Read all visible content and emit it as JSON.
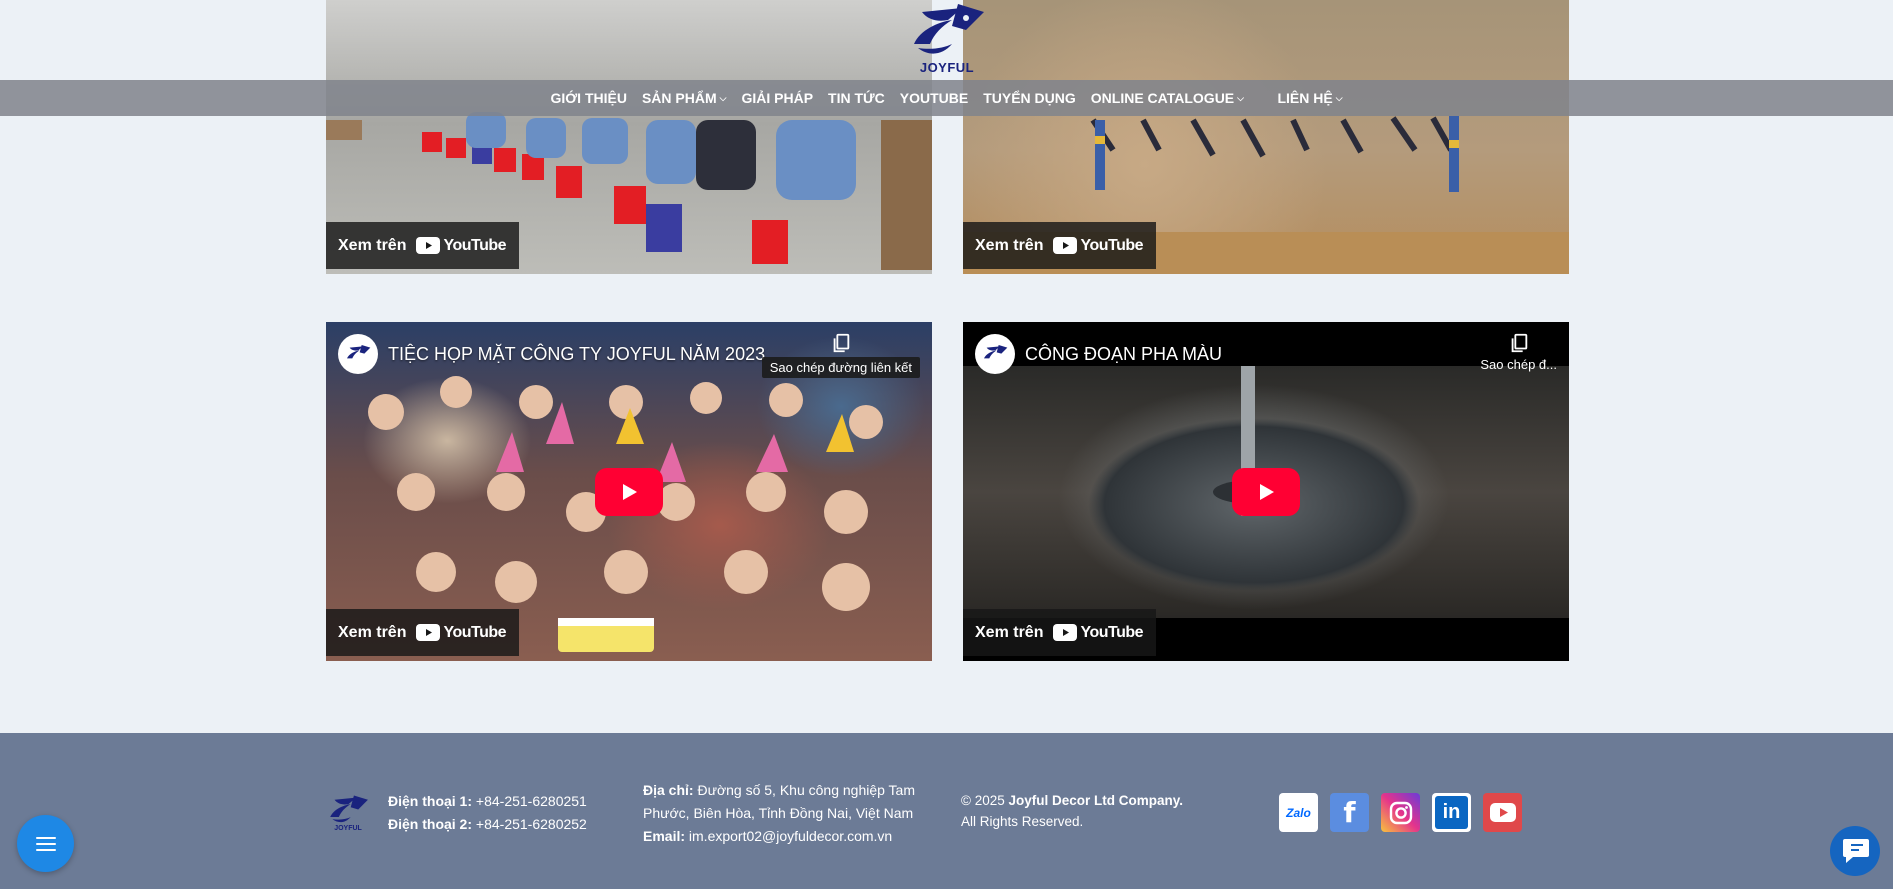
{
  "brand": {
    "logo_text": "JOYFUL",
    "accent": "#1a237e",
    "play_red": "#ff0033"
  },
  "nav": {
    "items": [
      {
        "label": "GIỚI THIỆU",
        "dropdown": false
      },
      {
        "label": "SẢN PHẨM",
        "dropdown": true
      },
      {
        "label": "GIẢI PHÁP",
        "dropdown": false
      },
      {
        "label": "TIN TỨC",
        "dropdown": false
      },
      {
        "label": "YOUTUBE",
        "dropdown": false
      },
      {
        "label": "TUYỂN DỤNG",
        "dropdown": false
      },
      {
        "label": "ONLINE CATALOGUE",
        "dropdown": true
      },
      {
        "label": "LIÊN HỆ",
        "dropdown": true
      }
    ],
    "caret": "⌵"
  },
  "videos": {
    "top_left": {
      "watch_label": "Xem trên",
      "yt_text": "YouTube"
    },
    "top_right": {
      "watch_label": "Xem trên",
      "yt_text": "YouTube"
    },
    "bottom_left": {
      "title": "TIỆC HỌP MẶT CÔNG TY JOYFUL NĂM 2023",
      "copy_label": "Sao chép đường liên kết",
      "watch_label": "Xem trên",
      "yt_text": "YouTube"
    },
    "bottom_right": {
      "title": "CÔNG ĐOẠN PHA MÀU",
      "copy_label": "Sao chép đ...",
      "watch_label": "Xem trên",
      "yt_text": "YouTube"
    }
  },
  "footer": {
    "logo_text": "JOYFUL",
    "phone1_label": "Điện thoại 1:",
    "phone1": "+84-251-6280251",
    "phone2_label": "Điện thoại 2:",
    "phone2": "+84-251-6280252",
    "address_label": "Địa chỉ:",
    "address_line1": "Đường số 5, Khu công nghiệp Tam",
    "address_line2": "Phước, Biên Hòa, Tỉnh Đồng Nai, Việt Nam",
    "email_label": "Email:",
    "email": "im.export02@joyfuldecor.com.vn",
    "copyright_prefix": "© 2025",
    "company": "Joyful Decor Ltd Company.",
    "rights": "All Rights Reserved.",
    "social": [
      {
        "name": "zalo-icon",
        "label": "Zalo",
        "color": "#0068ff"
      },
      {
        "name": "facebook-icon",
        "label": "f",
        "color": "#3b5998"
      },
      {
        "name": "instagram-icon",
        "label": "",
        "color": "#d6249f"
      },
      {
        "name": "linkedin-icon",
        "label": "in",
        "color": "#0a66c2"
      },
      {
        "name": "youtube-icon",
        "label": "",
        "color": "#e52d27"
      }
    ]
  }
}
